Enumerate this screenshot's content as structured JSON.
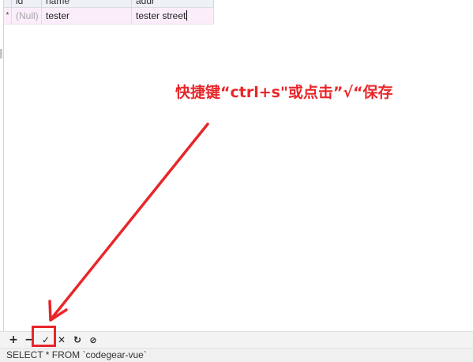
{
  "grid": {
    "columns": [
      "id",
      "name",
      "addr"
    ],
    "rows": [
      {
        "marker": "*",
        "id": "(Null)",
        "name": "tester",
        "addr": "tester street"
      }
    ]
  },
  "annotation": {
    "text": "快捷键“ctrl+s\"或点击”√“保存",
    "color": "#e8262a"
  },
  "toolbar": {
    "add_label": "+",
    "remove_label": "−",
    "apply_label": "✓",
    "discard_label": "✕",
    "refresh_label": "↻",
    "stop_label": "⊘",
    "icons": [
      "plus-icon",
      "minus-icon",
      "check-icon",
      "cross-icon",
      "refresh-icon",
      "stop-icon"
    ]
  },
  "status": {
    "sql": "SELECT * FROM `codegear-vue`"
  },
  "colors": {
    "annotation_red": "#e8262a",
    "row_bg": "#fbeefa",
    "header_bg": "#eef1f5"
  }
}
